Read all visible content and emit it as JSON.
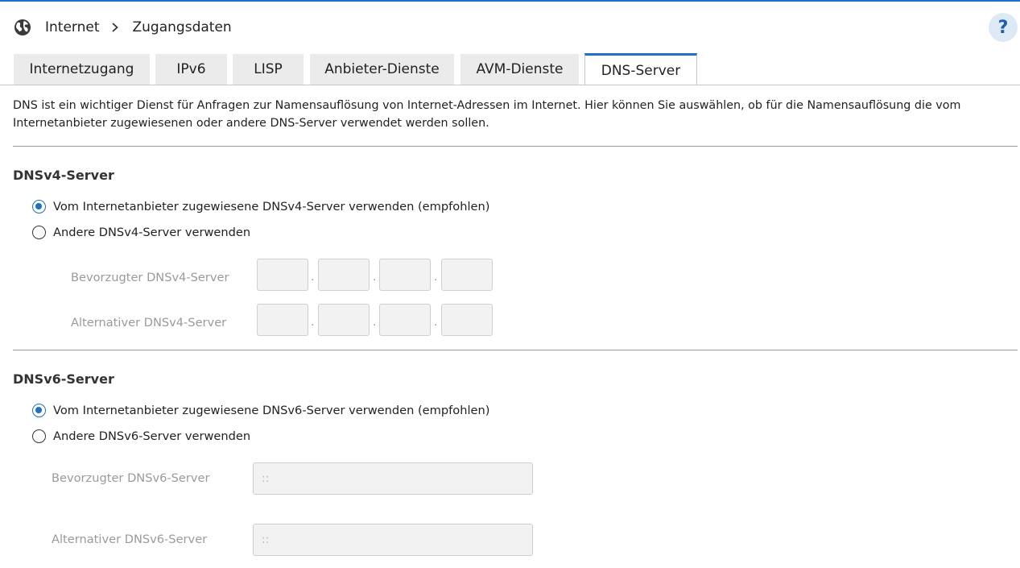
{
  "breadcrumb": {
    "section": "Internet",
    "page": "Zugangsdaten",
    "icon": "globe-icon"
  },
  "help_label": "?",
  "tabs": [
    {
      "label": "Internetzugang",
      "active": false
    },
    {
      "label": "IPv6",
      "active": false
    },
    {
      "label": "LISP",
      "active": false
    },
    {
      "label": "Anbieter-Dienste",
      "active": false
    },
    {
      "label": "AVM-Dienste",
      "active": false
    },
    {
      "label": "DNS-Server",
      "active": true
    }
  ],
  "intro": "DNS ist ein wichtiger Dienst für Anfragen zur Namensauflösung von Internet-Adressen im Internet. Hier können Sie auswählen, ob für die Namensauflösung die vom Internetanbieter zugewiesenen oder andere DNS-Server verwendet werden sollen.",
  "dnsv4": {
    "title": "DNSv4-Server",
    "option_provider": "Vom Internetanbieter zugewiesene DNSv4-Server verwenden (empfohlen)",
    "option_other": "Andere DNSv4-Server verwenden",
    "selected": "provider",
    "preferred_label": "Bevorzugter DNSv4-Server",
    "alternative_label": "Alternativer DNSv4-Server",
    "preferred_octets": [
      "",
      "",
      "",
      ""
    ],
    "alternative_octets": [
      "",
      "",
      "",
      ""
    ],
    "separator": "."
  },
  "dnsv6": {
    "title": "DNSv6-Server",
    "option_provider": "Vom Internetanbieter zugewiesene DNSv6-Server verwenden (empfohlen)",
    "option_other": "Andere DNSv6-Server verwenden",
    "selected": "provider",
    "preferred_label": "Bevorzugter DNSv6-Server",
    "alternative_label": "Alternativer DNSv6-Server",
    "preferred_placeholder": "::",
    "alternative_placeholder": "::"
  },
  "colors": {
    "accent": "#1f6fc5",
    "tab_bg": "#ebebeb",
    "disabled_text": "#9a9a9a",
    "help_bg": "#dde9f4"
  }
}
